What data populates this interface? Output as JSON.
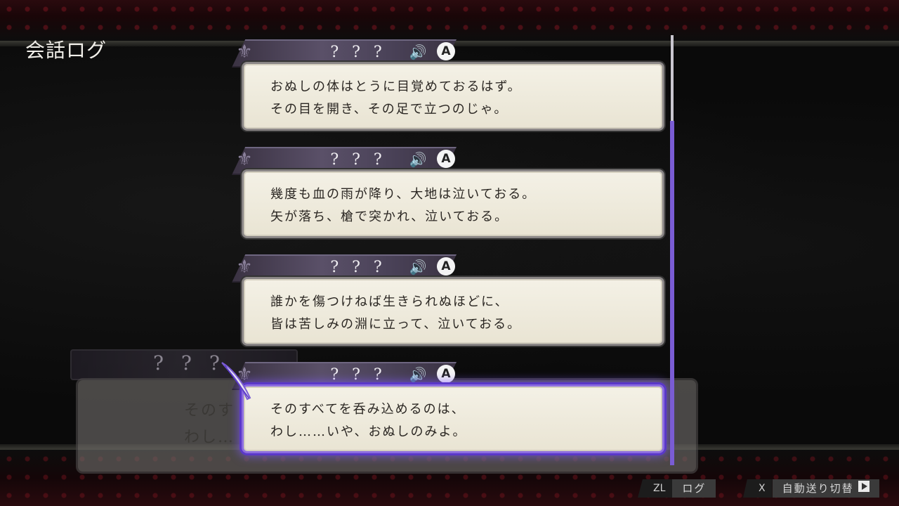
{
  "title": "会話ログ",
  "background_dialogue": {
    "speaker": "? ? ?",
    "line1": "そのす",
    "line2": "わし…"
  },
  "entries": [
    {
      "speaker": "? ? ?",
      "badge": "A",
      "line1": "おぬしの体はとうに目覚めておるはず。",
      "line2": "その目を開き、その足で立つのじゃ。"
    },
    {
      "speaker": "? ? ?",
      "badge": "A",
      "line1": "幾度も血の雨が降り、大地は泣いておる。",
      "line2": "矢が落ち、槍で突かれ、泣いておる。"
    },
    {
      "speaker": "? ? ?",
      "badge": "A",
      "line1": "誰かを傷つけねば生きられぬほどに、",
      "line2": "皆は苦しみの淵に立って、泣いておる。"
    },
    {
      "speaker": "? ? ?",
      "badge": "A",
      "line1": "そのすべてを呑み込めるのは、",
      "line2": "わし……いや、おぬしのみよ。"
    }
  ],
  "footer": {
    "log_key": "ZL",
    "log_label": "ログ",
    "auto_key": "X",
    "auto_label": "自動送り切替"
  },
  "colors": {
    "selection": "#7a5cd4",
    "text_panel": "#f4f1e6",
    "namebar": "#4a4258"
  },
  "icons": {
    "voice": "speaker-icon",
    "play": "play-icon",
    "cursor": "quill-icon"
  }
}
